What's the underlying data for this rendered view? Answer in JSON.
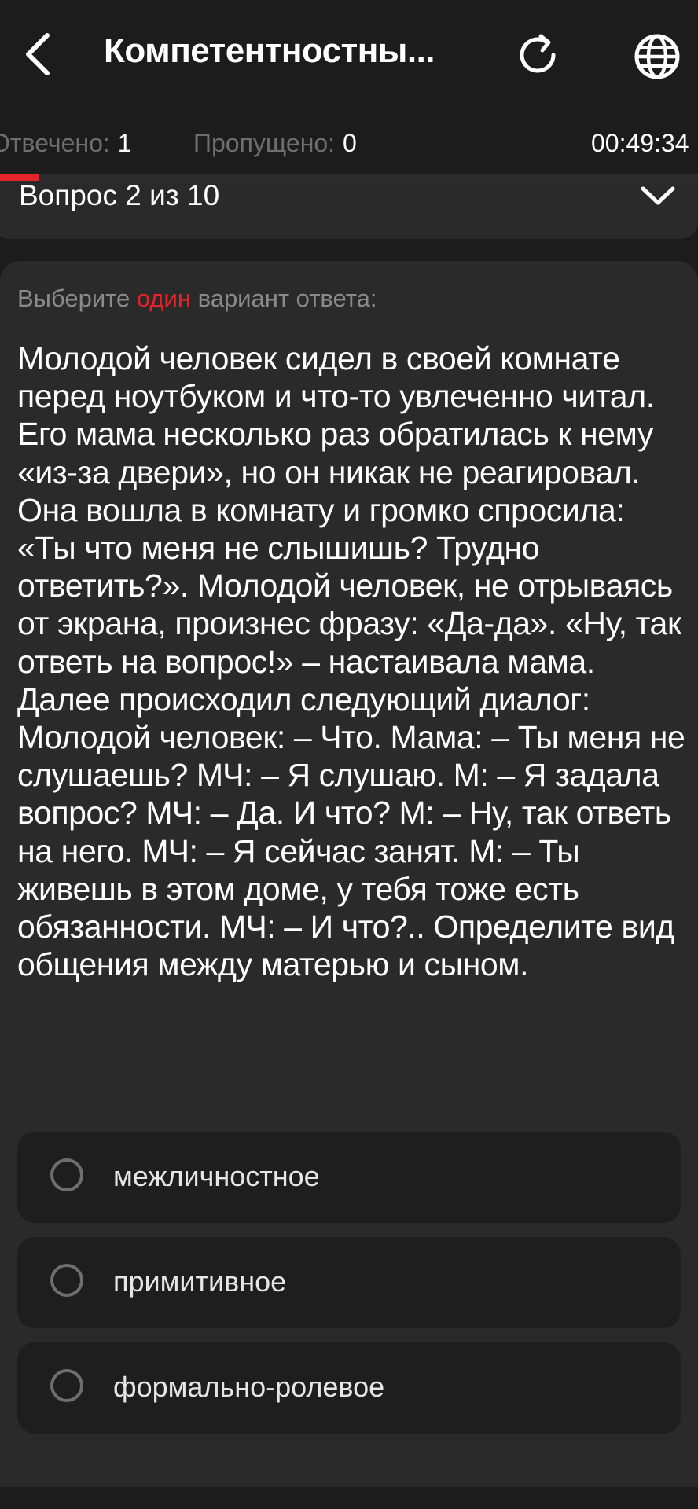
{
  "header": {
    "title": "Компетентностны...",
    "back_icon": "chevron-left-icon",
    "reload_icon": "reload-icon",
    "language_icon": "globe-icon"
  },
  "stats": {
    "answered_label": "Отвечено:",
    "answered_value": "1",
    "skipped_label": "Пропущено:",
    "skipped_value": "0",
    "timer": "00:49:34"
  },
  "progress": {
    "fraction": 0.055
  },
  "question_selector": {
    "label": "Вопрос 2 из 10",
    "icon": "chevron-down-icon"
  },
  "instruction": {
    "prefix": "Выберите ",
    "highlight": "один",
    "suffix": " вариант ответа:"
  },
  "question": {
    "text": "Молодой человек сидел в своей комнате перед ноутбуком и что-то увлеченно читал. Его мама несколько раз обратилась к нему «из-за двери», но он никак не реагировал. Она вошла в комнату и громко спросила: «Ты что меня не слышишь? Трудно ответить?». Молодой человек, не отрываясь от экрана, произнес фразу: «Да-да». «Ну, так ответь на вопрос!» – настаивала мама. Далее происходил следующий диалог: Молодой человек: – Что. Мама: – Ты меня не слушаешь? МЧ: – Я слушаю. М: – Я задала вопрос? МЧ: – Да. И что? М: – Ну, так ответь на него. МЧ: – Я сейчас занят. М: – Ты живешь в этом доме, у тебя тоже есть обязанности. МЧ: – И что?.. Определите вид общения между матерью и сыном."
  },
  "options": [
    {
      "label": "межличностное"
    },
    {
      "label": "примитивное"
    },
    {
      "label": "формально-ролевое"
    }
  ],
  "colors": {
    "background": "#1c1c1c",
    "card": "#2a2a2a",
    "option_bg": "#1e1e1e",
    "accent": "#e3242b",
    "muted": "#6e6e6e"
  }
}
